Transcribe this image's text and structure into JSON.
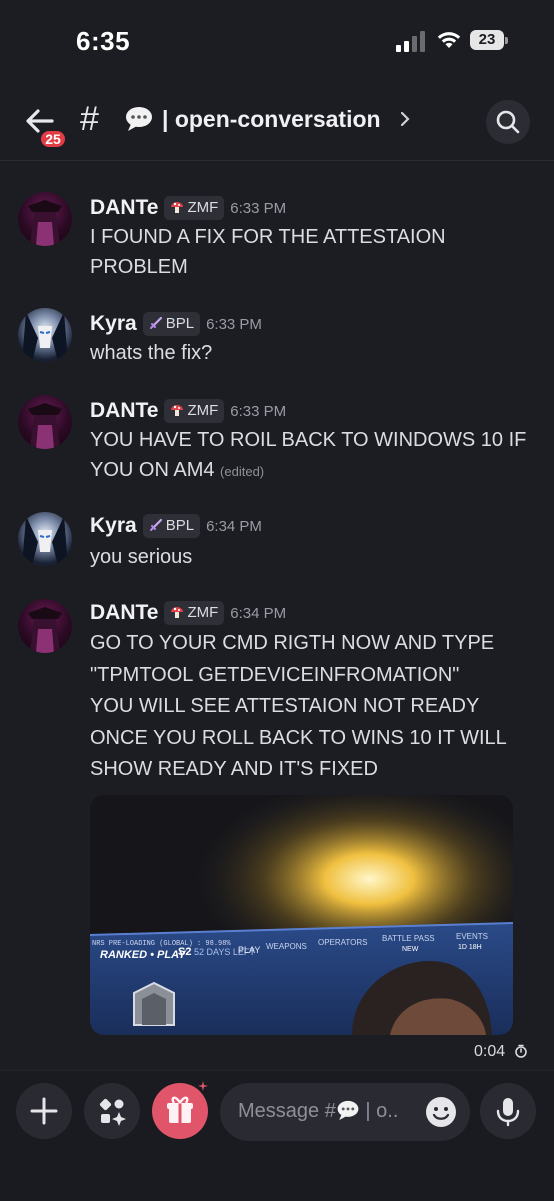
{
  "status_bar": {
    "time": "6:35",
    "battery": "23"
  },
  "header": {
    "back_badge": "25",
    "hash": "#",
    "channel_name": "| open-conversation"
  },
  "messages": [
    {
      "author": "DANTe",
      "tag": "ZMF",
      "time": "6:33 PM",
      "lines": [
        "I FOUND A FIX FOR THE ATTESTAION",
        "PROBLEM"
      ]
    },
    {
      "author": "Kyra",
      "tag": "BPL",
      "time": "6:33 PM",
      "lines": [
        "whats the fix?"
      ]
    },
    {
      "author": "DANTe",
      "tag": "ZMF",
      "time": "6:33 PM",
      "lines": [
        "YOU HAVE TO ROIL BACK TO WINDOWS 10 IF",
        "YOU ON AM4"
      ],
      "edited": "(edited)"
    },
    {
      "author": "Kyra",
      "tag": "BPL",
      "time": "6:34 PM",
      "lines": [
        "you serious"
      ]
    },
    {
      "author": "DANTe",
      "tag": "ZMF",
      "time": "6:34 PM",
      "lines": [
        "GO TO YOUR CMD RIGTH NOW AND TYPE",
        "\"TPMTOOL GETDEVICEINFROMATION\"",
        "YOU WILL SEE ATTESTAION NOT READY",
        "ONCE YOU ROLL BACK TO WINS 10 IT WILL",
        "SHOW READY AND IT'S FIXED"
      ]
    }
  ],
  "media": {
    "screen_text": {
      "preload": "NRS PRE-LOADING (GLOBAL) : 98.98%",
      "ranked": "RANKED • PLAY",
      "season": "S2",
      "days": "52 DAYS LEFT",
      "play": "PLAY",
      "weapons": "WEAPONS",
      "operators": "OPERATORS",
      "battle_pass": "BATTLE PASS",
      "battle_pass_sub": "NEW",
      "events": "EVENTS",
      "events_sub": "1D 18H"
    },
    "duration": "0:04"
  },
  "composer": {
    "placeholder": "Message #",
    "placeholder_tail": "| o.."
  },
  "colors": {
    "background": "#1c1d22",
    "badge": "#e23d44",
    "gift_button": "#e0556a",
    "tag_bg": "#2e2f37"
  }
}
